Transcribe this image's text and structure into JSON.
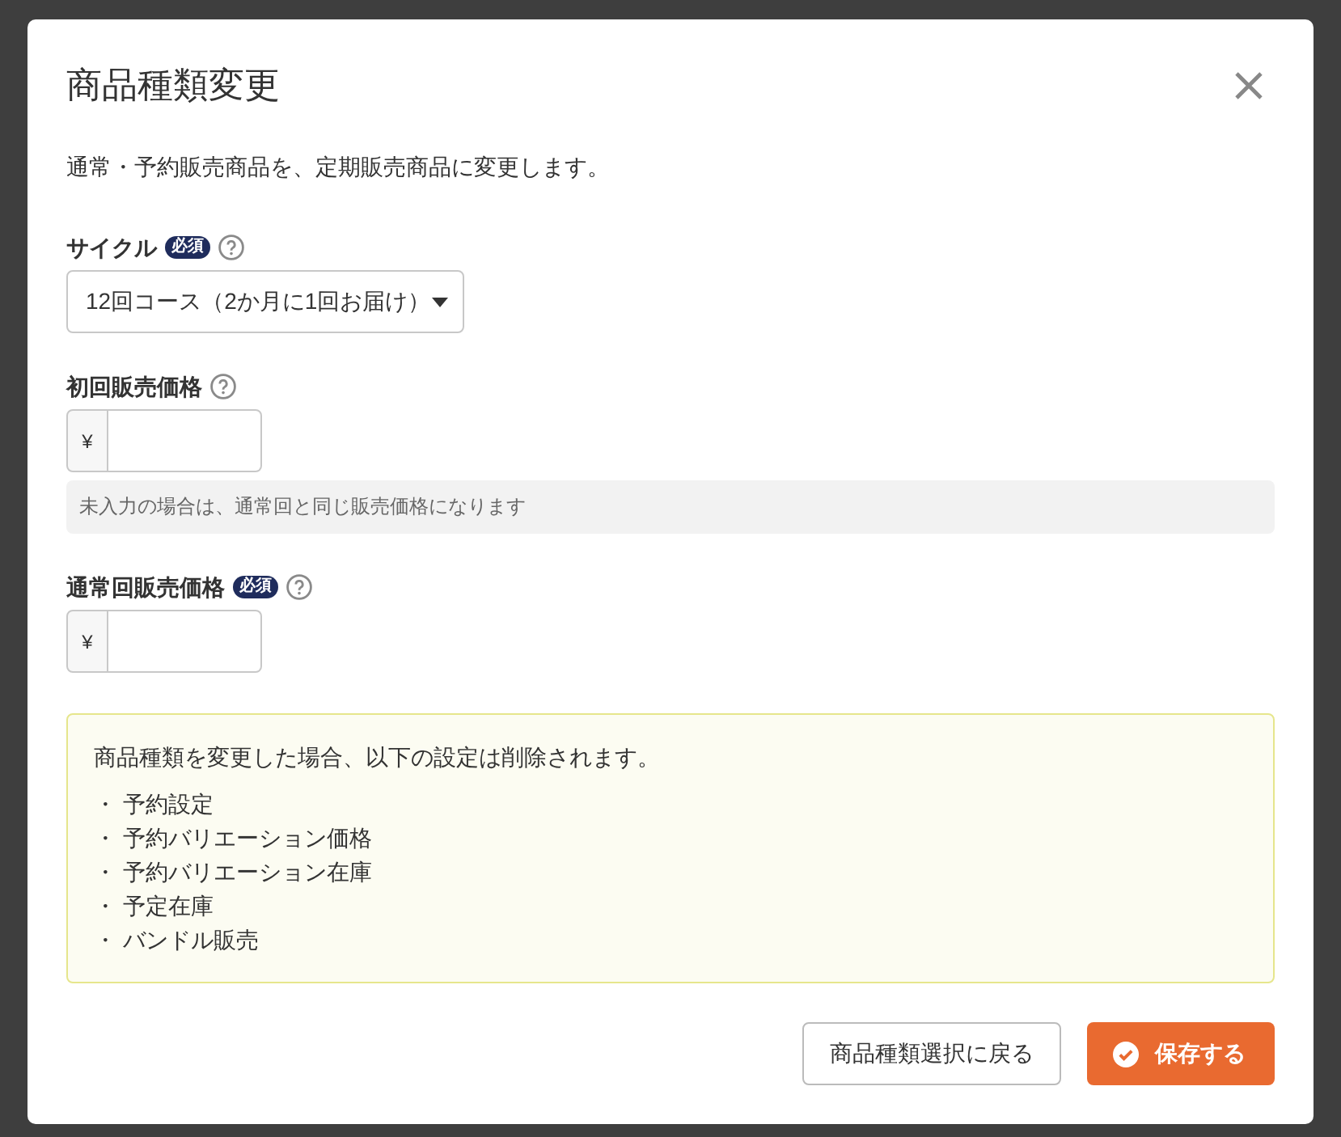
{
  "dialog": {
    "title": "商品種類変更",
    "description": "通常・予約販売商品を、定期販売商品に変更します。"
  },
  "fields": [
    {
      "kind": "select",
      "label": "サイクル",
      "badge": "必須",
      "value": "12回コース（2か月に1回お届け）"
    },
    {
      "kind": "price",
      "label": "初回販売価格",
      "prefix": "¥",
      "note": "未入力の場合は、通常回と同じ販売価格になります"
    },
    {
      "kind": "price",
      "label": "通常回販売価格",
      "badge": "必須",
      "prefix": "¥"
    }
  ],
  "warning": {
    "message": "商品種類を変更した場合、以下の設定は削除されます。",
    "items": [
      {
        "bullet": "・",
        "text": "予約設定"
      },
      {
        "bullet": "・",
        "text": "予約バリエーション価格"
      },
      {
        "bullet": "・",
        "text": "予約バリエーション在庫"
      },
      {
        "bullet": "・",
        "text": "予定在庫"
      },
      {
        "bullet": "・",
        "text": "バンドル販売"
      }
    ]
  },
  "buttons": [
    {
      "kind": "secondary",
      "label": "商品種類選択に戻る"
    },
    {
      "kind": "primary",
      "label": "保存する"
    }
  ]
}
